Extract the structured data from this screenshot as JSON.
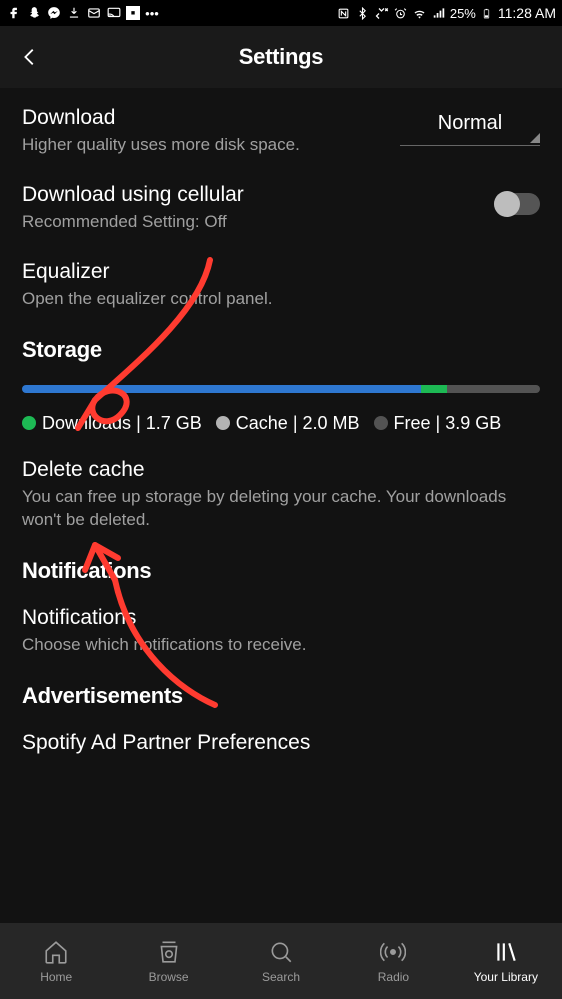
{
  "status_bar": {
    "battery_percent": "25%",
    "time": "11:28 AM"
  },
  "header": {
    "title": "Settings"
  },
  "rows": {
    "download": {
      "title": "Download",
      "subtitle": "Higher quality uses more disk space.",
      "value": "Normal"
    },
    "cellular": {
      "title": "Download using cellular",
      "subtitle": "Recommended Setting: Off"
    },
    "equalizer": {
      "title": "Equalizer",
      "subtitle": "Open the equalizer control panel."
    },
    "delete_cache": {
      "title": "Delete cache",
      "subtitle": "You can free up storage by deleting your cache. Your downloads won't be deleted."
    },
    "notifications_item": {
      "title": "Notifications",
      "subtitle": "Choose which notifications to receive."
    },
    "ad_prefs": {
      "title": "Spotify Ad Partner Preferences"
    }
  },
  "sections": {
    "storage": "Storage",
    "notifications": "Notifications",
    "advertisements": "Advertisements"
  },
  "storage": {
    "downloads": {
      "label": "Downloads",
      "value": "1.7 GB",
      "color": "#1db954",
      "percent": 77
    },
    "cache": {
      "label": "Cache",
      "value": "2.0 MB",
      "color": "#b3b3b3",
      "percent": 0
    },
    "free": {
      "label": "Free",
      "value": "3.9 GB",
      "color": "#535353",
      "percent": 18
    },
    "other_percent": 5,
    "bar_main_color": "#2e77d0",
    "bar_downloads_color": "#1db954",
    "bar_free_color": "#535353"
  },
  "nav": {
    "home": "Home",
    "browse": "Browse",
    "search": "Search",
    "radio": "Radio",
    "library": "Your Library"
  },
  "annotation_color": "#ff3b30"
}
